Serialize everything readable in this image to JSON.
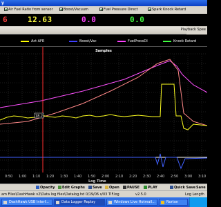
{
  "window": {
    "title": "y"
  },
  "sensors": [
    {
      "label": "Air Fuel Ratio from sensor",
      "checked": true
    },
    {
      "label": "Boost/Vacuum",
      "checked": true
    },
    {
      "label": "Fuel Pressure Direct",
      "checked": true
    },
    {
      "label": "Spark Knock Retard",
      "checked": true
    }
  ],
  "readouts": [
    {
      "value": "6",
      "color": "#ff4040"
    },
    {
      "value": "12.63",
      "color": "#ffff40"
    },
    {
      "value": "0.0",
      "color": "#ff40ff"
    },
    {
      "value": "0.0",
      "color": "#40ff40"
    }
  ],
  "playback": {
    "label": "Playback Spee"
  },
  "legend": [
    {
      "name": "Act AFR",
      "color": "#ffff00"
    },
    {
      "name": "Boost/Vac",
      "color": "#4040ff"
    },
    {
      "name": "FuelPressDI",
      "color": "#ff40ff"
    },
    {
      "name": "Knock Retard",
      "color": "#40ff40"
    }
  ],
  "chart_data": {
    "type": "line",
    "title": "Samples",
    "xlabel": "Log Time",
    "xticks": [
      "0:50",
      "1:00",
      "1:10",
      "1:20",
      "1:30",
      "1:40",
      "1:50",
      "2:00",
      "2:10",
      "2:20",
      "2:30",
      "2:40",
      "2:50",
      "3:00",
      "3:10"
    ],
    "cursor_label": "18.2",
    "grid": true
  },
  "toolbar": {
    "opacity": "Opacity",
    "edit_graphs": "Edit Graphs",
    "save1": "Save",
    "open": "Open",
    "pause": "PAUSE",
    "play": "PLAY",
    "quick_save": "Quick Save",
    "save2": "Save"
  },
  "status": {
    "path": "am Files\\DashHawk v2\\Data log files\\Datalog.hd 0/19/06 s/03 TIF.log",
    "version": "v2.5.0",
    "right": "Log Length"
  },
  "taskbar": [
    {
      "label": "DashHawk USB Interf..."
    },
    {
      "label": "Data Logger Replay"
    },
    {
      "label": "Windows Live Hotmail..."
    },
    {
      "label": "Norton"
    }
  ]
}
